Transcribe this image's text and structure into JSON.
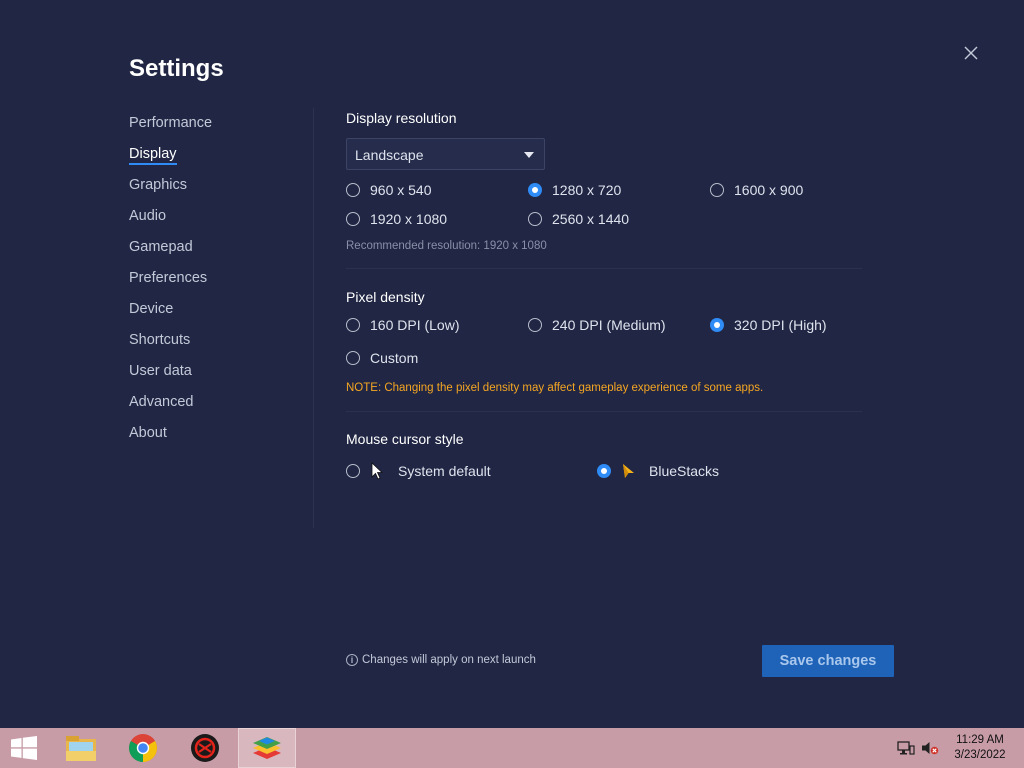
{
  "window": {
    "title": "Settings"
  },
  "sidebar": {
    "items": [
      {
        "label": "Performance",
        "active": false
      },
      {
        "label": "Display",
        "active": true
      },
      {
        "label": "Graphics",
        "active": false
      },
      {
        "label": "Audio",
        "active": false
      },
      {
        "label": "Gamepad",
        "active": false
      },
      {
        "label": "Preferences",
        "active": false
      },
      {
        "label": "Device",
        "active": false
      },
      {
        "label": "Shortcuts",
        "active": false
      },
      {
        "label": "User data",
        "active": false
      },
      {
        "label": "Advanced",
        "active": false
      },
      {
        "label": "About",
        "active": false
      }
    ]
  },
  "display_resolution": {
    "title": "Display resolution",
    "orientation": "Landscape",
    "options": [
      {
        "label": "960 x 540",
        "checked": false
      },
      {
        "label": "1280 x 720",
        "checked": true
      },
      {
        "label": "1600 x 900",
        "checked": false
      },
      {
        "label": "1920 x 1080",
        "checked": false
      },
      {
        "label": "2560 x 1440",
        "checked": false
      }
    ],
    "recommended": "Recommended resolution: 1920 x 1080"
  },
  "pixel_density": {
    "title": "Pixel density",
    "options": [
      {
        "label": "160 DPI (Low)",
        "checked": false
      },
      {
        "label": "240 DPI (Medium)",
        "checked": false
      },
      {
        "label": "320 DPI (High)",
        "checked": true
      },
      {
        "label": "Custom",
        "checked": false
      }
    ],
    "note": "NOTE: Changing the pixel density may affect gameplay experience of some apps."
  },
  "mouse_cursor": {
    "title": "Mouse cursor style",
    "options": [
      {
        "label": "System default",
        "checked": false,
        "icon": "arrow-cursor-icon"
      },
      {
        "label": "BlueStacks",
        "checked": true,
        "icon": "bluestacks-cursor-icon"
      }
    ]
  },
  "footer": {
    "info": "Changes will apply on next launch",
    "save_label": "Save changes"
  },
  "taskbar": {
    "time": "11:29 AM",
    "date": "3/23/2022",
    "apps": [
      "start-icon",
      "file-explorer-icon",
      "chrome-icon",
      "game-app-icon",
      "bluestacks-icon"
    ]
  },
  "colors": {
    "background": "#202643",
    "accent": "#2f8bf5",
    "note": "#f5a623",
    "save_button": "#1e63b8",
    "taskbar": "#c79ca7"
  }
}
